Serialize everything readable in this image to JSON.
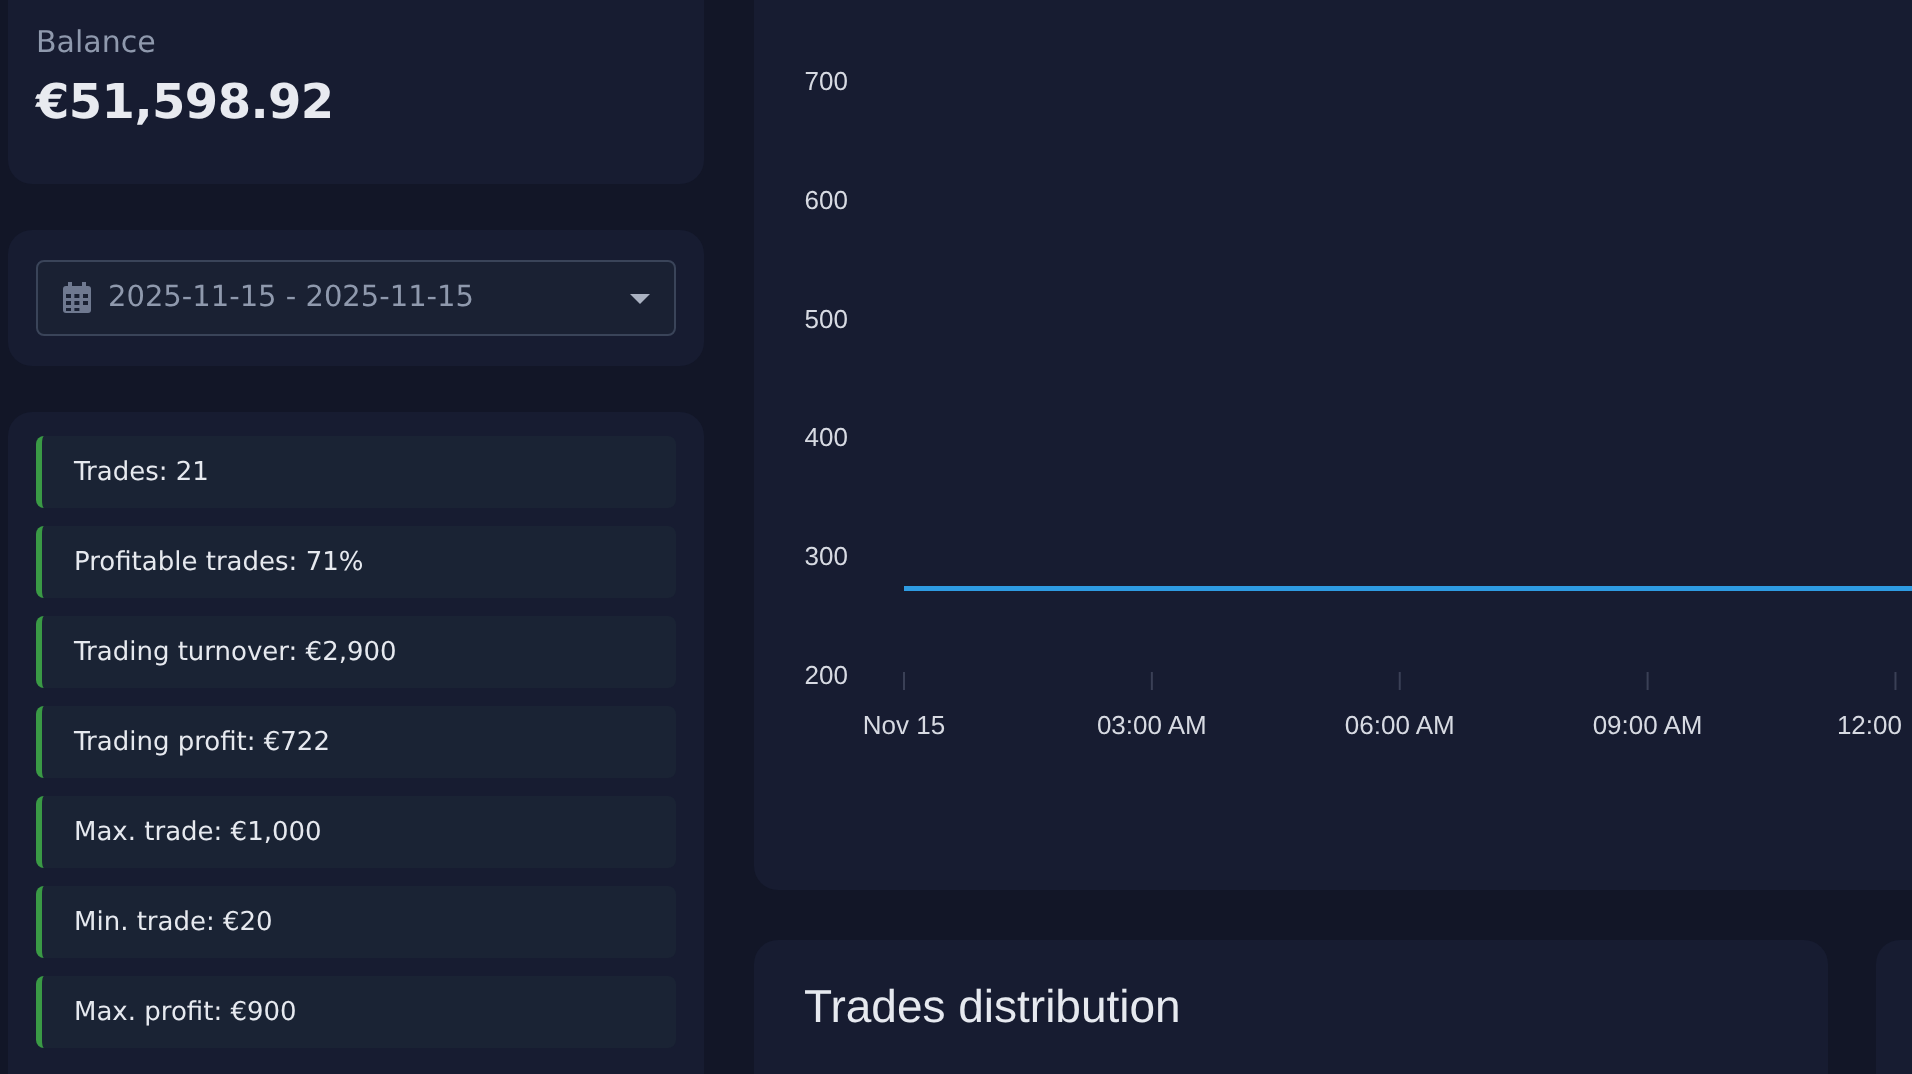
{
  "balance": {
    "label": "Balance",
    "value": "€51,598.92"
  },
  "date_range": {
    "value": "2025-11-15 - 2025-11-15"
  },
  "stats": [
    {
      "text": "Trades: 21",
      "color": "#3a9a45"
    },
    {
      "text": "Profitable trades: 71%",
      "color": "#3a9a45"
    },
    {
      "text": "Trading turnover: €2,900",
      "color": "#3a9a45"
    },
    {
      "text": "Trading profit: €722",
      "color": "#3a9a45"
    },
    {
      "text": "Max. trade: €1,000",
      "color": "#3a9a45"
    },
    {
      "text": "Min. trade: €20",
      "color": "#3a9a45"
    },
    {
      "text": "Max. profit: €900",
      "color": "#3a9a45"
    }
  ],
  "balance_chart": {
    "chart_data": {
      "type": "line",
      "x": [
        0,
        12.2
      ],
      "series": [
        {
          "color": "#2e9be2",
          "values": [
            272,
            272
          ]
        }
      ],
      "xlim": [
        0,
        12.2
      ],
      "ylim": [
        200,
        700
      ],
      "yticks": [
        200,
        300,
        400,
        500,
        600,
        700
      ],
      "xticks": [
        {
          "value": 0,
          "label": "Nov 15"
        },
        {
          "value": 3,
          "label": "03:00 AM"
        },
        {
          "value": 6,
          "label": "06:00 AM"
        },
        {
          "value": 9,
          "label": "09:00 AM"
        },
        {
          "value": 12,
          "label": "12:00"
        }
      ]
    }
  },
  "distribution": {
    "title": "Trades distribution"
  }
}
